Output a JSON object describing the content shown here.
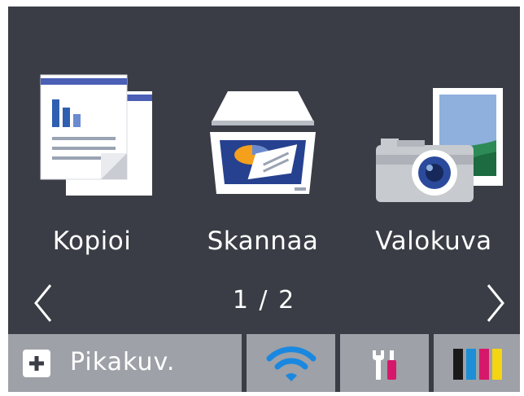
{
  "apps": [
    {
      "label": "Kopioi",
      "icon": "copy-icon"
    },
    {
      "label": "Skannaa",
      "icon": "scanner-icon"
    },
    {
      "label": "Valokuva",
      "icon": "camera-photo-icon"
    }
  ],
  "pager": {
    "text": "1 / 2"
  },
  "bottom_bar": {
    "shortcut_label": "Pikakuv.",
    "wifi_icon": "wifi-icon",
    "tools_icon": "wrench-screwdriver-icon",
    "ink_icon": "ink-cartridges-icon"
  },
  "colors": {
    "screen_bg": "#3a3d45",
    "button_bg": "#9ea1a7",
    "wifi": "#1a88e0",
    "ink_black": "#1a1a1a",
    "ink_cyan": "#1c8fd8",
    "ink_magenta": "#d6186a",
    "ink_yellow": "#f5d411"
  }
}
